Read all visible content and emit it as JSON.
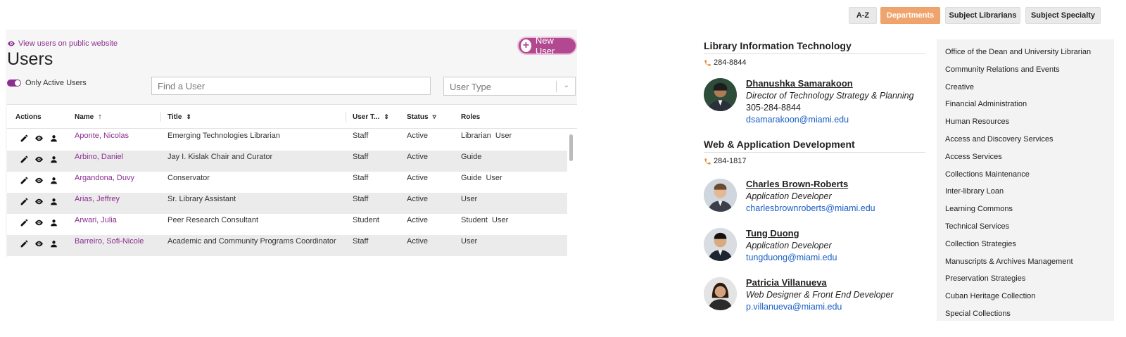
{
  "admin": {
    "view_link": "View users on public website",
    "title": "Users",
    "new_user": "New User",
    "only_active": "Only Active Users",
    "search_placeholder": "Find a User",
    "usertype_placeholder": "User Type",
    "columns": {
      "actions": "Actions",
      "name": "Name",
      "title": "Title",
      "user_type": "User T...",
      "status": "Status",
      "roles": "Roles"
    },
    "rows": [
      {
        "name": "Aponte, Nicolas",
        "title": "Emerging Technologies Librarian",
        "type": "Staff",
        "status": "Active",
        "roles": "Librarian  User"
      },
      {
        "name": "Arbino, Daniel",
        "title": "Jay I. Kislak Chair and Curator",
        "type": "Staff",
        "status": "Active",
        "roles": "Guide"
      },
      {
        "name": "Argandona, Duvy",
        "title": "Conservator",
        "type": "Staff",
        "status": "Active",
        "roles": "Guide  User"
      },
      {
        "name": "Arias, Jeffrey",
        "title": "Sr. Library Assistant",
        "type": "Staff",
        "status": "Active",
        "roles": "User"
      },
      {
        "name": "Arwari, Julia",
        "title": "Peer Research Consultant",
        "type": "Student",
        "status": "Active",
        "roles": "Student  User"
      },
      {
        "name": "Barreiro, Sofi-Nicole",
        "title": "Academic and Community Programs Coordinator",
        "type": "Staff",
        "status": "Active",
        "roles": "User"
      }
    ]
  },
  "topnav": {
    "az": "A-Z",
    "departments": "Departments",
    "subject_librarians": "Subject Librarians",
    "subject_specialty": "Subject Specialty"
  },
  "directory": {
    "departments": [
      {
        "name": "Library Information Technology",
        "phone": "284-8844",
        "people": [
          {
            "name": "Dhanushka Samarakoon",
            "role": "Director of Technology Strategy & Planning",
            "phone": "305-284-8844",
            "email": "dsamarakoon@miami.edu"
          }
        ]
      },
      {
        "name": "Web & Application Development",
        "phone": "284-1817",
        "people": [
          {
            "name": "Charles Brown-Roberts",
            "role": "Application Developer",
            "email": "charlesbrownroberts@miami.edu"
          },
          {
            "name": "Tung Duong",
            "role": "Application Developer",
            "email": "tungduong@miami.edu"
          },
          {
            "name": "Patricia Villanueva",
            "role": "Web Designer & Front End Developer",
            "email": "p.villanueva@miami.edu"
          }
        ]
      }
    ]
  },
  "sidebar": {
    "items": [
      "Office of the Dean and University Librarian",
      "Community Relations and Events",
      "Creative",
      "Financial Administration",
      "Human Resources",
      "Access and Discovery Services",
      "Access Services",
      "Collections Maintenance",
      "Inter-library Loan",
      "Learning Commons",
      "Technical Services",
      "Collection Strategies",
      "Manuscripts & Archives Management",
      "Preservation Strategies",
      "Cuban Heritage Collection",
      "Special Collections"
    ]
  },
  "colors": {
    "accent_purple": "#8b2f8f",
    "new_user_bg": "#b2488f",
    "departments_orange": "#f0a46d",
    "phone_icon": "#e8882e",
    "email_blue": "#1a5fc4"
  }
}
